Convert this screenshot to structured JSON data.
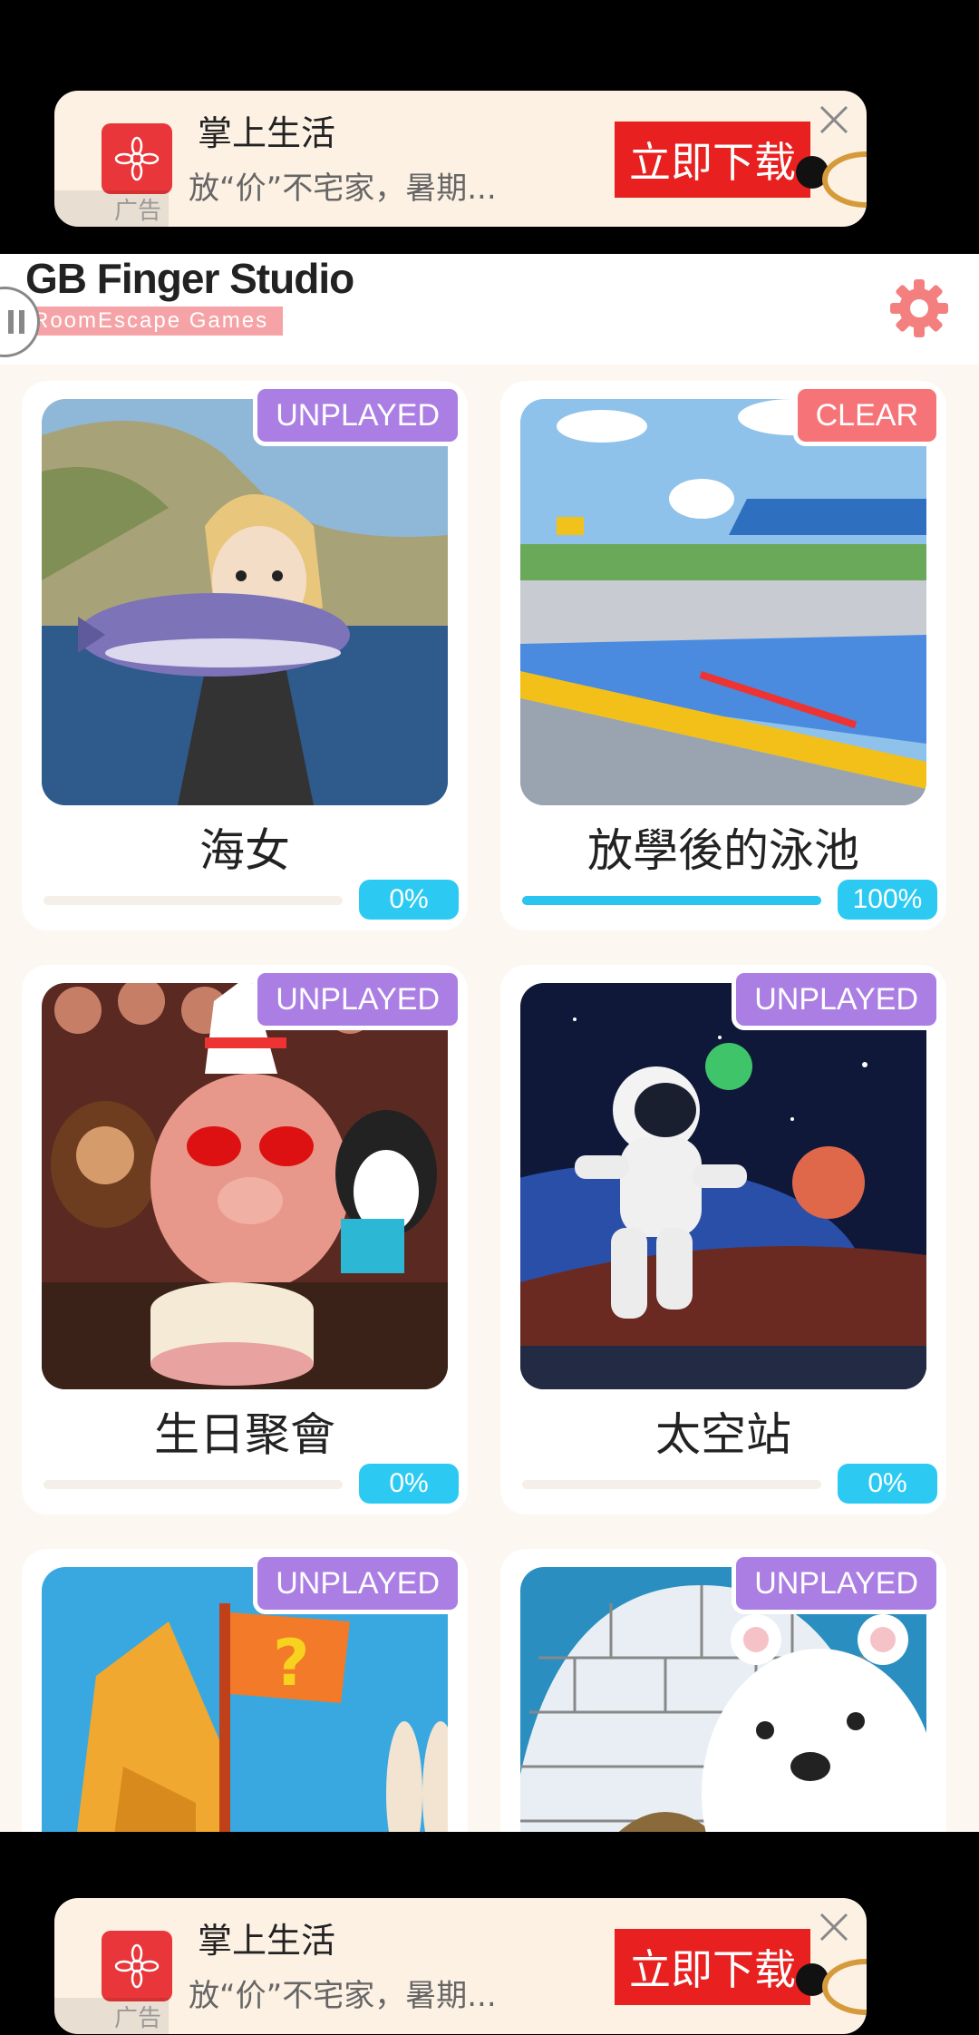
{
  "ads": {
    "top": {
      "title": "掌上生活",
      "subtitle": "放“价”不宅家，暑期...",
      "cta": "立即下载",
      "tag": "广告"
    },
    "bottom": {
      "title": "掌上生活",
      "subtitle": "放“价”不宅家，暑期...",
      "cta": "立即下载",
      "tag": "广告"
    }
  },
  "header": {
    "title": "GB Finger Studio",
    "subtitle": "RoomEscape  Games",
    "settings_icon": "gear-icon"
  },
  "games": [
    {
      "title": "海女",
      "status": "UNPLAYED",
      "progress_label": "0%",
      "progress": 0
    },
    {
      "title": "放學後的泳池",
      "status": "CLEAR",
      "progress_label": "100%",
      "progress": 1.0
    },
    {
      "title": "生日聚會",
      "status": "UNPLAYED",
      "progress_label": "0%",
      "progress": 0
    },
    {
      "title": "太空站",
      "status": "UNPLAYED",
      "progress_label": "0%",
      "progress": 0
    },
    {
      "title": "",
      "status": "UNPLAYED"
    },
    {
      "title": "",
      "status": "UNPLAYED"
    }
  ],
  "colors": {
    "unplayed": "#ab7ee4",
    "clear": "#f67478",
    "progress": "#2ccaf3",
    "brand_accent": "#f5a3a6",
    "gear": "#f3807f"
  }
}
